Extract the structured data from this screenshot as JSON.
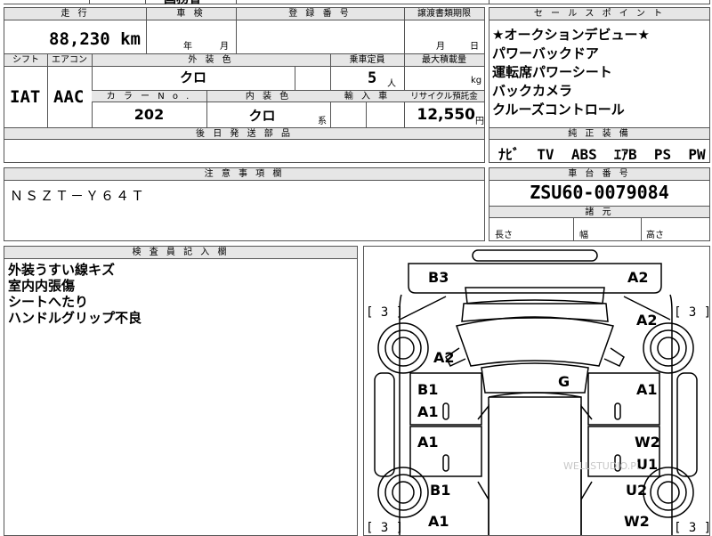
{
  "top_partial": "国務省",
  "mileage": {
    "label": "走 行",
    "value": "88,230",
    "unit": "km"
  },
  "inspection": {
    "label": "車 検",
    "year": "年",
    "month": "月"
  },
  "registration": {
    "label": "登 録 番 号"
  },
  "transfer_deadline": {
    "label": "譲渡書類期限",
    "month": "月",
    "day": "日"
  },
  "selling_points": {
    "label": "セ ー ル ス ポ イ ン ト",
    "items": [
      "★オークションデビュー★",
      "パワーバックドア",
      "運転席パワーシート",
      "バックカメラ",
      "クルーズコントロール"
    ]
  },
  "shift": {
    "label": "シフト",
    "value": "IAT"
  },
  "ac": {
    "label": "エアコン",
    "value": "AAC"
  },
  "exterior_color": {
    "label": "外 装 色",
    "value": "クロ"
  },
  "capacity": {
    "label": "乗車定員",
    "value": "5",
    "unit": "人"
  },
  "max_load": {
    "label": "最大積載量",
    "unit": "kg"
  },
  "color_no": {
    "label": "カ ラ ー N o .",
    "value": "202"
  },
  "interior_color": {
    "label": "内 装 色",
    "value": "クロ",
    "suffix": "系"
  },
  "import": {
    "label": "輸 入 車"
  },
  "recycle": {
    "label": "リサイクル預託金",
    "value": "12,550",
    "unit": "円"
  },
  "later_parts": {
    "label": "後 日 発 送 部 品"
  },
  "equipment": {
    "label": "純 正 装 備",
    "items": [
      "ﾅﾋﾞ",
      "TV",
      "ABS",
      "ｴｱB",
      "PS",
      "PW"
    ]
  },
  "notes": {
    "label": "注 意 事 項 欄",
    "value": "ＮＳＺＴ－Ｙ６４Ｔ"
  },
  "chassis": {
    "label": "車 台 番 号",
    "value": "ZSU60-0079084"
  },
  "specs": {
    "label": "諸 元",
    "length": "長さ",
    "width": "幅",
    "height": "高さ"
  },
  "inspector": {
    "label": "検 査 員 記 入 欄",
    "items": [
      "外装うすい線キズ",
      "室内内張傷",
      "シートへたり",
      "ハンドルグリップ不良"
    ]
  },
  "diagram": {
    "marks": {
      "b3": "B3",
      "a2_tr": "A2",
      "a2_r2": "A2",
      "a2_l": "A2",
      "b1_l1": "B1",
      "a1_l1": "A1",
      "g": "G",
      "a1_r1": "A1",
      "a1_l2": "A1",
      "w2_r1": "W2",
      "u1_r": "U1",
      "b1_l2": "B1",
      "u2_r": "U2",
      "a1_l3": "A1",
      "w2_r2": "W2"
    },
    "tread": {
      "fl": "[ 3 ]",
      "fr": "[ 3 ]",
      "rl": "[ 3 ]",
      "rr": "[ 3 ]"
    },
    "watermark": "WELLSTUDIO.PL"
  }
}
